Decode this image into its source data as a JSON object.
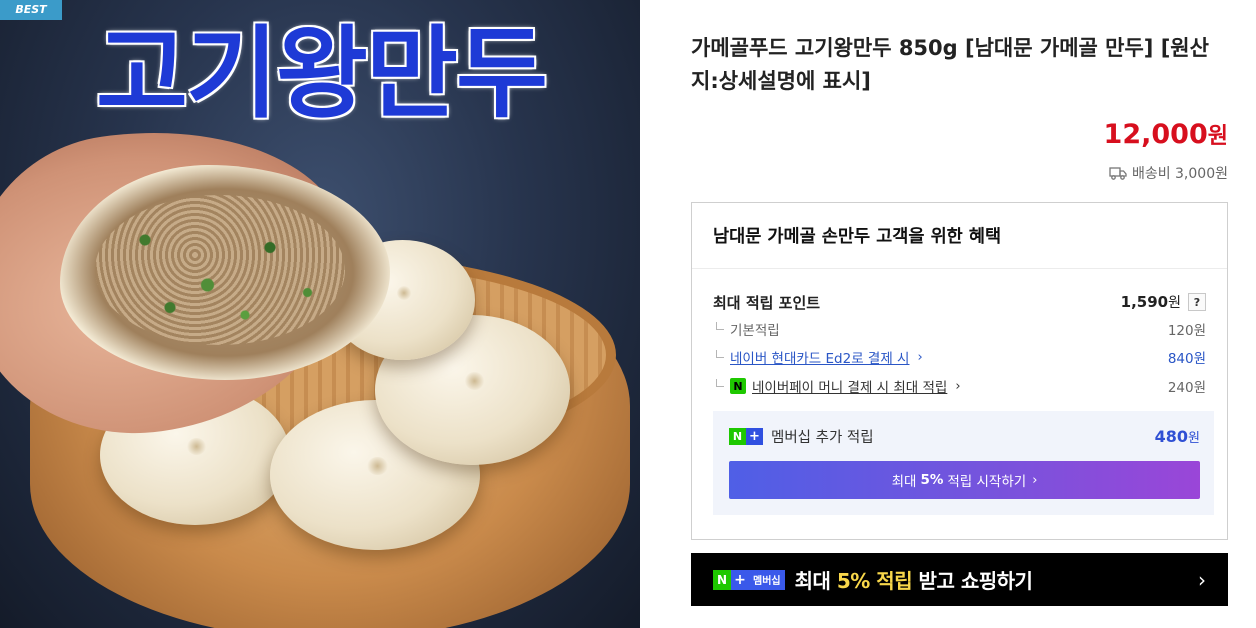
{
  "image": {
    "badge": "BEST",
    "title_text": "고기왕만두"
  },
  "product": {
    "title": "가메골푸드 고기왕만두 850g [남대문 가메골 만두] [원산지:상세설명에 표시]",
    "price_value": "12,000",
    "price_unit": "원",
    "shipping": "배송비 3,000원",
    "price_color": "#d70f1e"
  },
  "benefit": {
    "heading": "남대문 가메골 손만두 고객을 위한 혜택",
    "points_label": "최대 적립 포인트",
    "points_value": "1,590",
    "points_unit": "원",
    "help_label": "?",
    "items": [
      {
        "label": "기본적립",
        "value": "120원"
      },
      {
        "label": "네이버 현대카드 Ed2로 결제 시",
        "value": "840원"
      },
      {
        "label": "네이버페이 머니 결제 시 최대 적립",
        "value": "240원",
        "icon_text": "N"
      }
    ],
    "membership": {
      "badge_n": "N",
      "badge_plus": "+",
      "label": "멤버십 추가 적립",
      "value": "480",
      "unit": "원",
      "button_pre": "최대 ",
      "button_bold": "5%",
      "button_post": " 적립 시작하기"
    }
  },
  "banner": {
    "badge_n": "N",
    "badge_plus": "+",
    "badge_text": "멤버십",
    "text_pre": "최대 ",
    "text_accent": "5% 적립",
    "text_post": " 받고 쇼핑하기",
    "arrow": "›"
  },
  "colors": {
    "naver_green": "#1ec800",
    "link_blue": "#2a56c6",
    "member_blue": "#3050d4"
  }
}
